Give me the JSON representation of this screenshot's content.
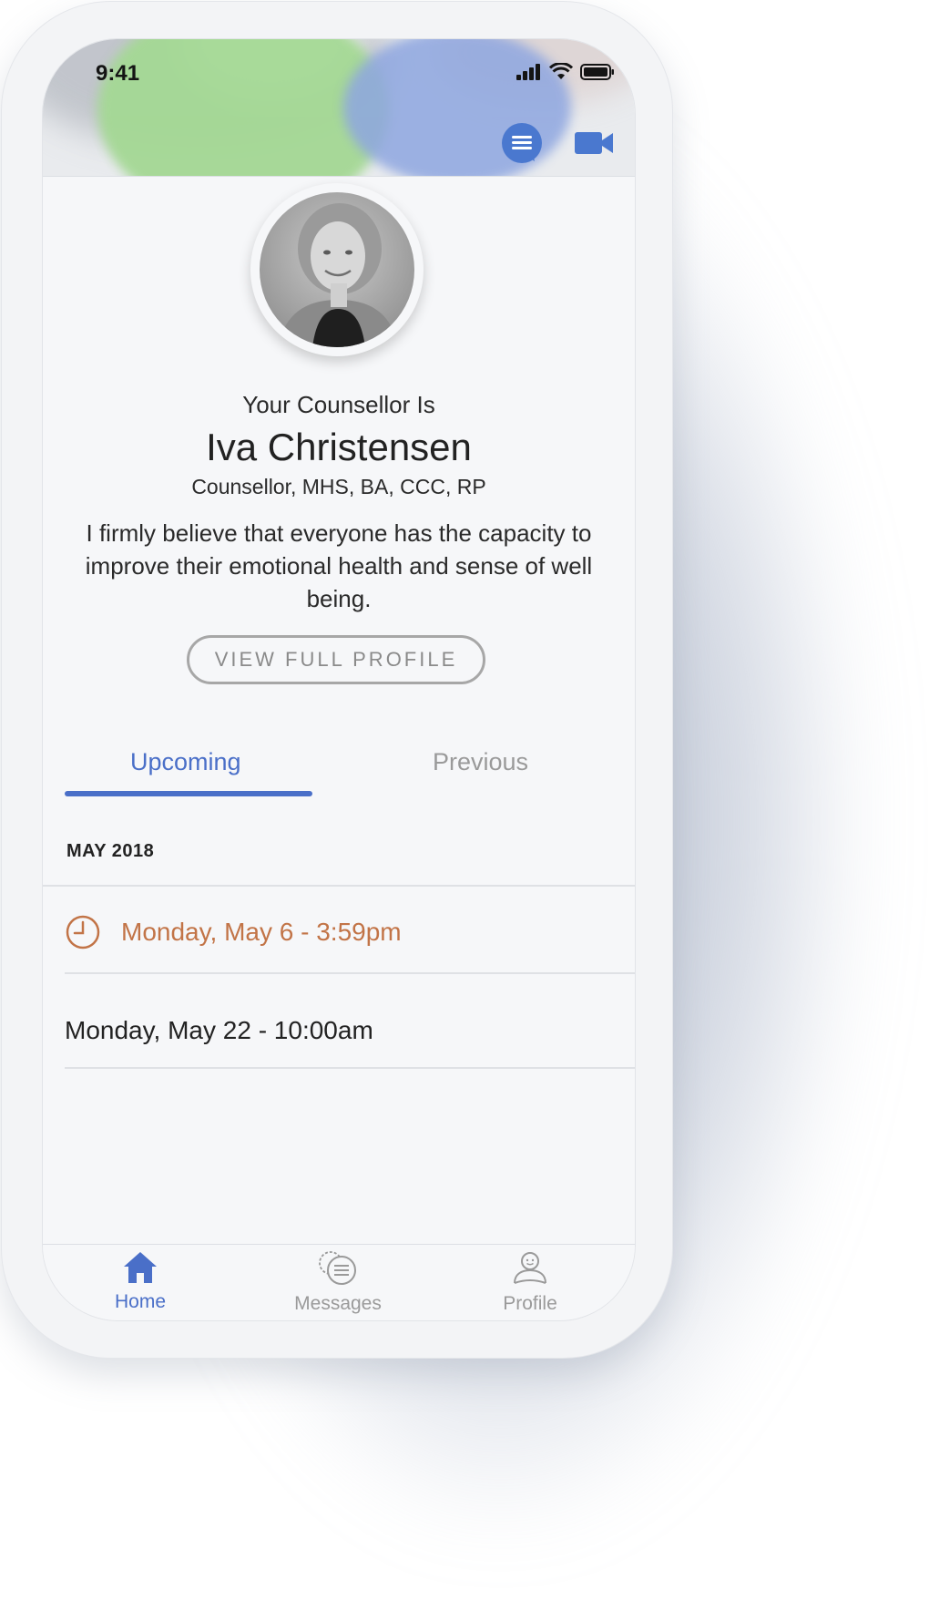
{
  "status_bar": {
    "time": "9:41"
  },
  "header": {
    "chat_icon": "chat-icon",
    "video_icon": "video-camera-icon"
  },
  "counsellor": {
    "intro": "Your Counsellor Is",
    "name": "Iva Christensen",
    "credentials": "Counsellor, MHS, BA,  CCC, RP",
    "bio": "I firmly believe that everyone has the capacity to improve their emotional health and sense of well being.",
    "profile_button": "VIEW FULL PROFILE"
  },
  "tabs": [
    {
      "label": "Upcoming",
      "active": true
    },
    {
      "label": "Previous",
      "active": false
    }
  ],
  "appointments": {
    "month": "MAY 2018",
    "items": [
      {
        "label": "Monday, May 6 - 3:59pm",
        "highlighted": true,
        "icon": "clock-icon"
      },
      {
        "label": "Monday, May 22 - 10:00am",
        "highlighted": false
      }
    ]
  },
  "tab_bar": [
    {
      "label": "Home",
      "icon": "home-icon",
      "active": true
    },
    {
      "label": "Messages",
      "icon": "messages-icon",
      "active": false
    },
    {
      "label": "Profile",
      "icon": "profile-icon",
      "active": false
    }
  ],
  "colors": {
    "accent_blue": "#4a6fc8",
    "appointment_orange": "#c27447",
    "background": "#f6f7f9"
  }
}
